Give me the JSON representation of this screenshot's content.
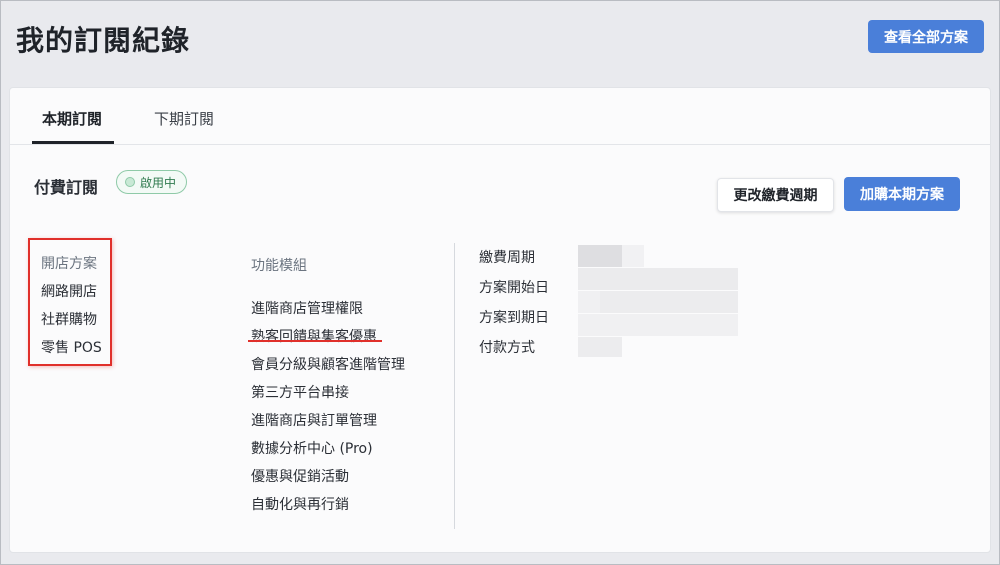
{
  "page": {
    "title": "我的訂閱紀錄",
    "view_all_button": "查看全部方案"
  },
  "tabs": [
    {
      "label": "本期訂閱",
      "active": true
    },
    {
      "label": "下期訂閱",
      "active": false
    }
  ],
  "subscription": {
    "title": "付費訂閱",
    "status": "啟用中",
    "change_cycle_button": "更改繳費週期",
    "add_plan_button": "加購本期方案"
  },
  "store_plan": {
    "label": "開店方案",
    "items": [
      "網路開店",
      "社群購物",
      "零售 POS"
    ]
  },
  "modules": {
    "label": "功能模組",
    "items": [
      "進階商店管理權限",
      "熟客回饋與集客優惠",
      "會員分級與顧客進階管理",
      "第三方平台串接",
      "進階商店與訂單管理",
      "數據分析中心 (Pro)",
      "優惠與促銷活動",
      "自動化與再行銷"
    ]
  },
  "billing": {
    "labels": [
      "繳費周期",
      "方案開始日",
      "方案到期日",
      "付款方式"
    ]
  },
  "colors": {
    "primary": "#4a7fd9",
    "highlight": "#e0302b",
    "status_green": "#2f7a4e"
  }
}
